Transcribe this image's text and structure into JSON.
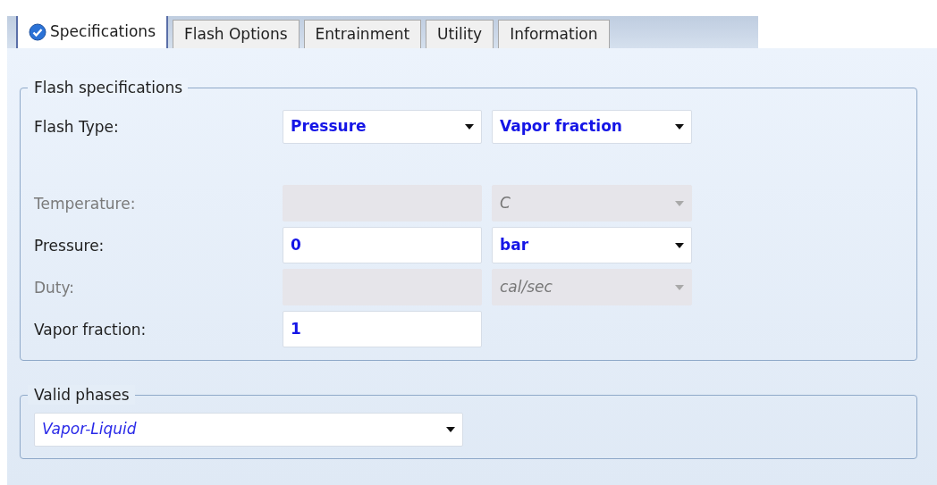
{
  "tabs": [
    {
      "label": "Specifications",
      "selected": true,
      "complete": true
    },
    {
      "label": "Flash Options",
      "selected": false,
      "complete": false
    },
    {
      "label": "Entrainment",
      "selected": false,
      "complete": false
    },
    {
      "label": "Utility",
      "selected": false,
      "complete": false
    },
    {
      "label": "Information",
      "selected": false,
      "complete": false
    }
  ],
  "flash_specifications": {
    "legend": "Flash specifications",
    "flash_type": {
      "label": "Flash Type:",
      "selects": [
        {
          "value": "Pressure"
        },
        {
          "value": "Vapor fraction"
        }
      ]
    },
    "rows": [
      {
        "label": "Temperature:",
        "disabled": true,
        "unit": {
          "value": "C",
          "disabled": true,
          "default": true
        }
      },
      {
        "label": "Pressure:",
        "disabled": false,
        "value": "0",
        "unit": {
          "value": "bar",
          "disabled": false,
          "default": false
        }
      },
      {
        "label": "Duty:",
        "disabled": true,
        "unit": {
          "value": "cal/sec",
          "disabled": true,
          "default": true
        }
      },
      {
        "label": "Vapor fraction:",
        "disabled": false,
        "value": "1"
      }
    ]
  },
  "valid_phases": {
    "legend": "Valid phases",
    "select": {
      "value": "Vapor-Liquid",
      "default": true
    }
  }
}
